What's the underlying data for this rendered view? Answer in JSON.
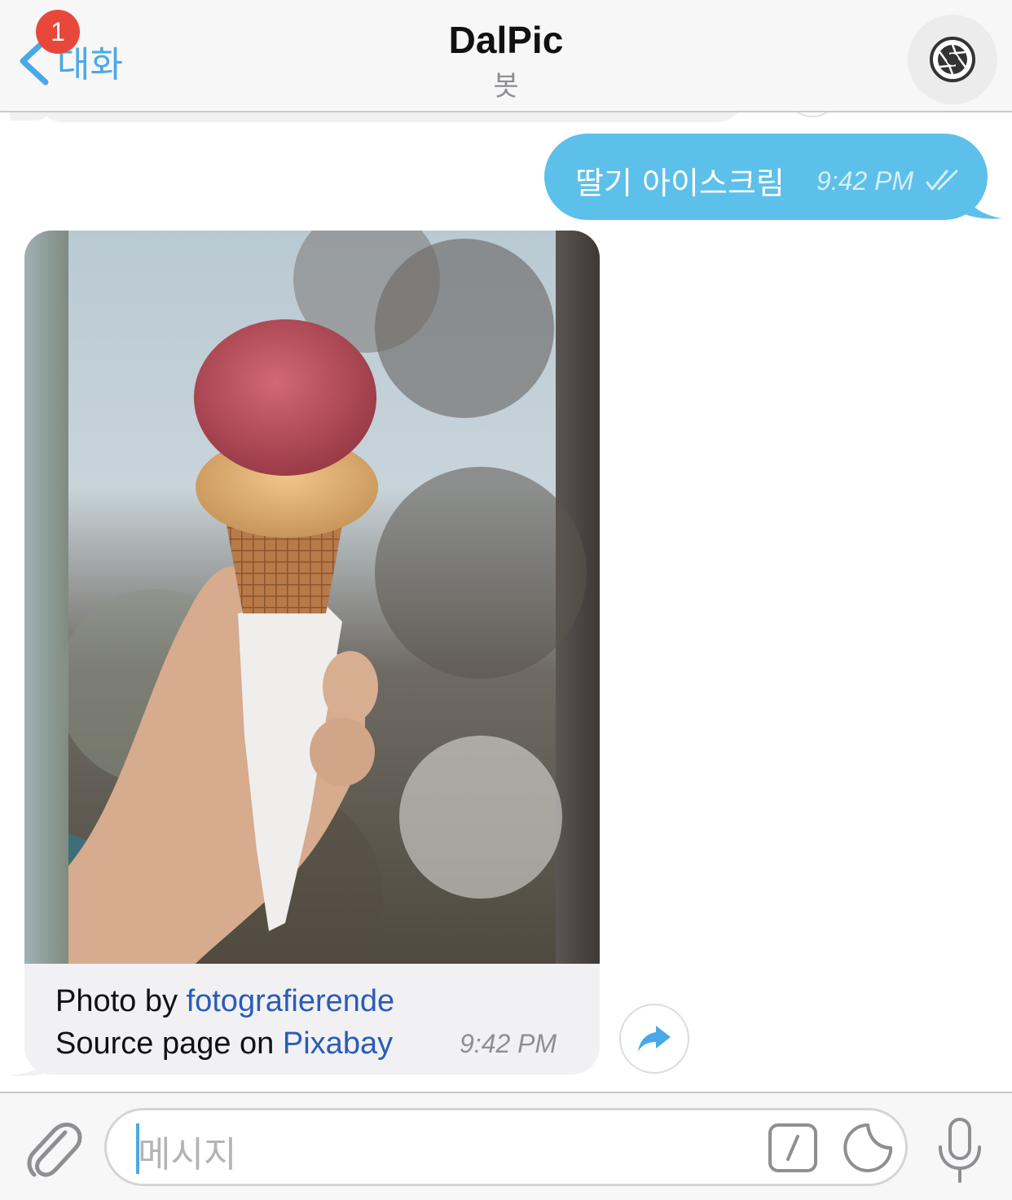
{
  "header": {
    "back_label": "대화",
    "unread_badge": "1",
    "title": "DalPic",
    "subtitle": "봇"
  },
  "messages": {
    "outgoing": {
      "text": "딸기 아이스크림",
      "time": "9:42 PM",
      "status": "read"
    },
    "incoming": {
      "image_subject": "ice-cream-cone-photo",
      "caption_photo_prefix": "Photo by ",
      "caption_author": "fotografierende",
      "caption_source_prefix": "Source page on ",
      "caption_source": "Pixabay",
      "time": "9:42 PM"
    }
  },
  "input": {
    "placeholder": "메시지"
  },
  "colors": {
    "accent": "#4ba8e8",
    "outgoing_bubble": "#5cc0ea",
    "incoming_bubble": "#f1f1f4",
    "badge": "#e8473c",
    "link": "#2a5bb8"
  },
  "icons": {
    "back": "chevron-left-icon",
    "avatar": "camera-aperture-icon",
    "read_status": "double-check-icon",
    "share": "share-arrow-icon",
    "attach": "paperclip-icon",
    "commands": "slash-command-icon",
    "stickers": "sticker-icon",
    "voice": "microphone-icon"
  }
}
